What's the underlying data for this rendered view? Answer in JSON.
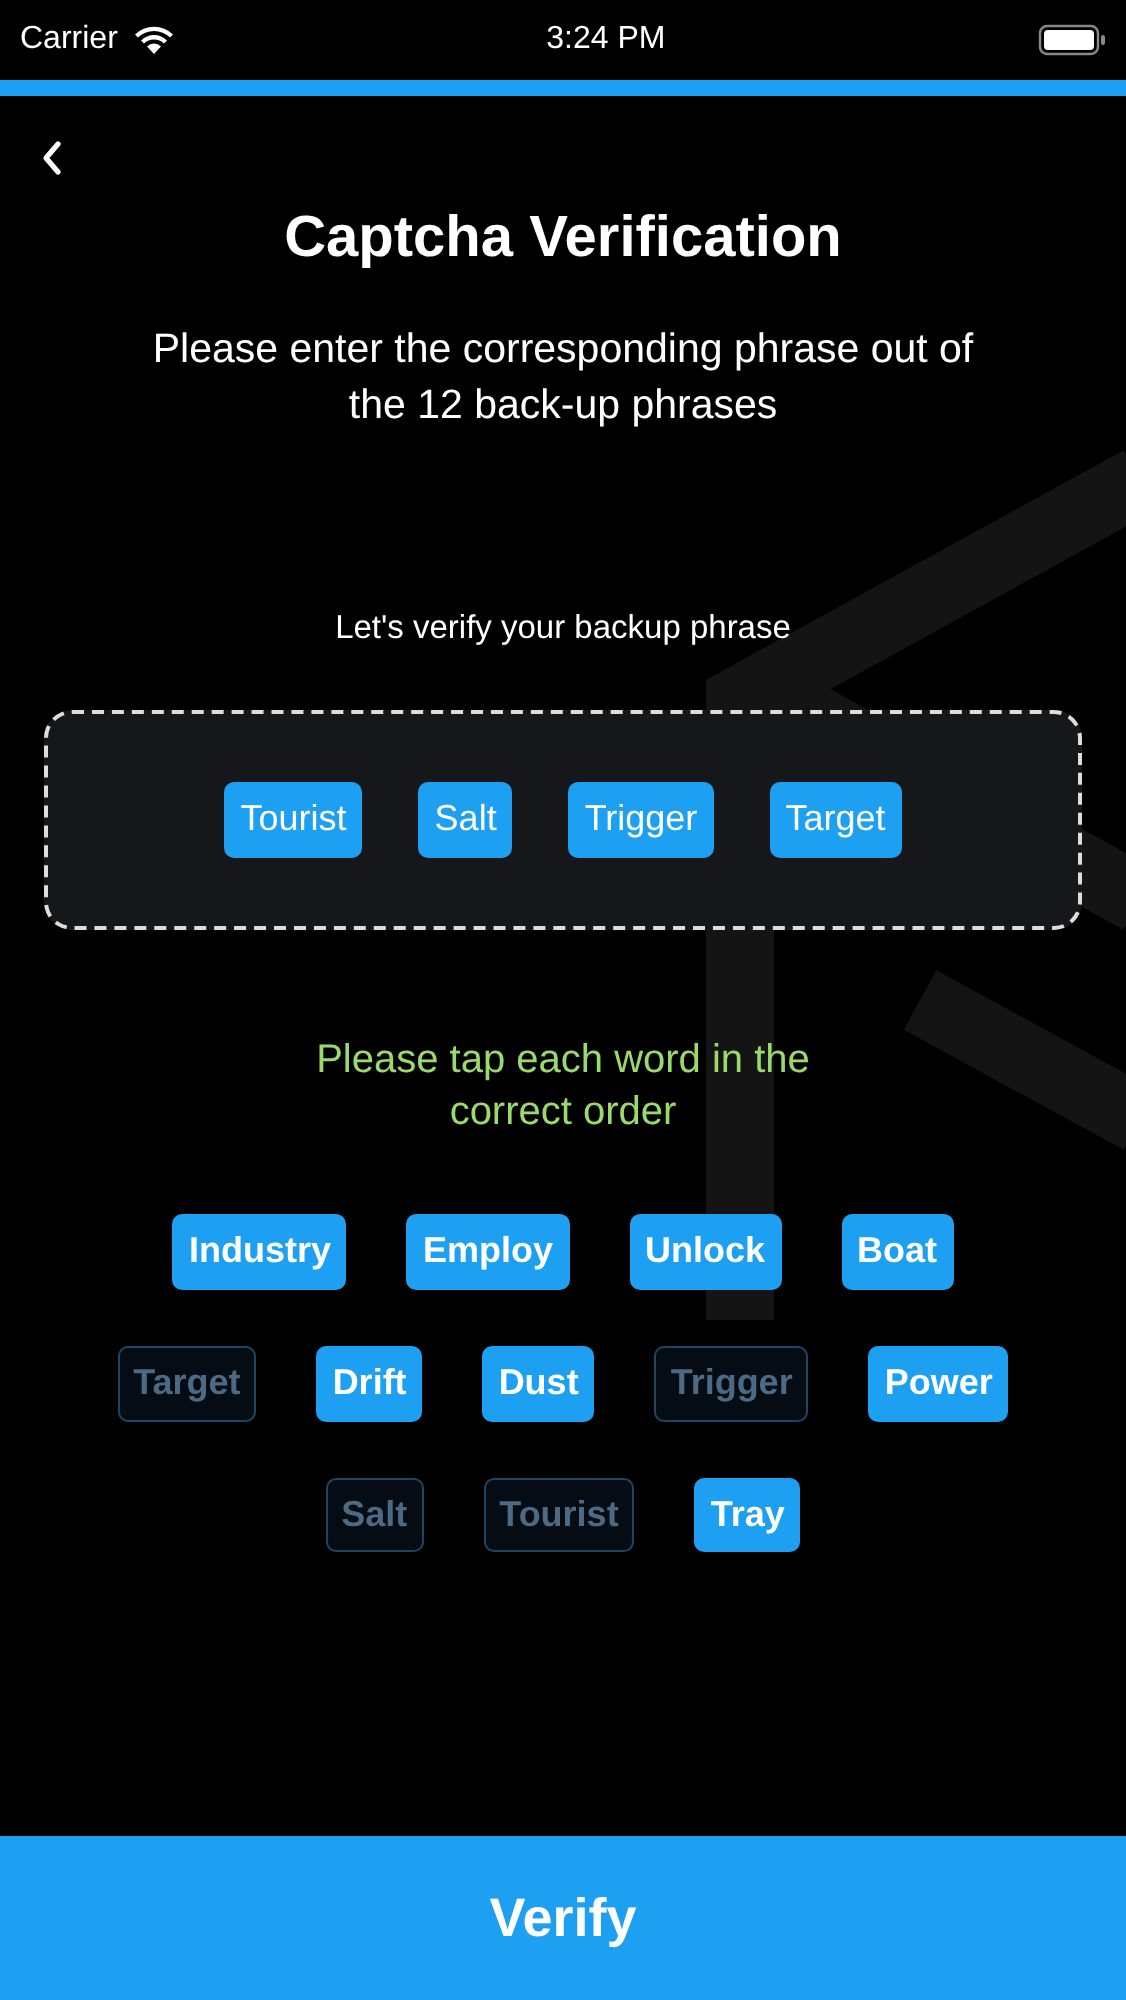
{
  "status_bar": {
    "carrier": "Carrier",
    "time": "3:24 PM"
  },
  "progress": {
    "level": 1
  },
  "title": "Captcha Verification",
  "subtitle": "Please enter the corresponding phrase out of the 12 back-up phrases",
  "verify_label": "Let's verify your backup phrase",
  "selected_words": [
    "Tourist",
    "Salt",
    "Trigger",
    "Target"
  ],
  "instruction": "Please tap each word in the correct order",
  "word_rows": [
    [
      {
        "label": "Industry",
        "used": false
      },
      {
        "label": "Employ",
        "used": false
      },
      {
        "label": "Unlock",
        "used": false
      },
      {
        "label": "Boat",
        "used": false
      }
    ],
    [
      {
        "label": "Target",
        "used": true
      },
      {
        "label": "Drift",
        "used": false
      },
      {
        "label": "Dust",
        "used": false
      },
      {
        "label": "Trigger",
        "used": true
      },
      {
        "label": "Power",
        "used": false
      }
    ],
    [
      {
        "label": "Salt",
        "used": true
      },
      {
        "label": "Tourist",
        "used": true
      },
      {
        "label": "Tray",
        "used": false
      }
    ]
  ],
  "primary_button": "Verify"
}
